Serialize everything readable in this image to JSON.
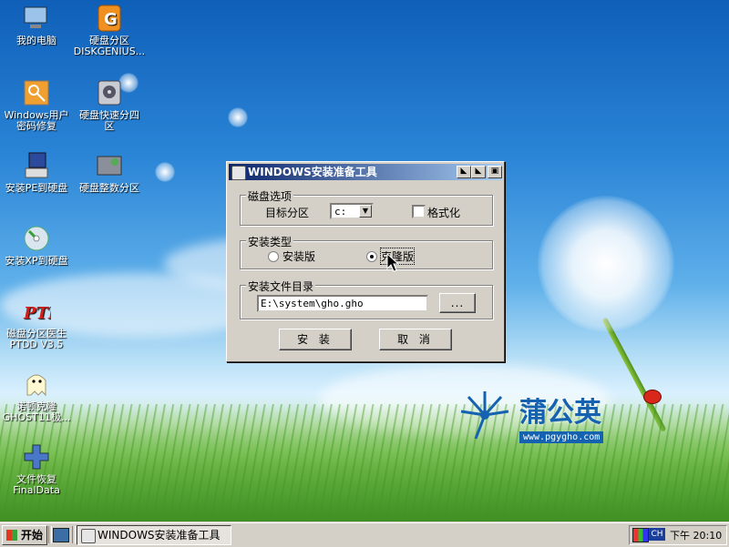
{
  "desktop": {
    "icons": [
      {
        "label": "我的电脑"
      },
      {
        "label": "硬盘分区\nDISKGENIUS..."
      },
      {
        "label": "Windows用户\n密码修复"
      },
      {
        "label": "硬盘快速分四\n区"
      },
      {
        "label": "安装PE到硬盘"
      },
      {
        "label": "硬盘整数分区"
      },
      {
        "label": "安装XP到硬盘"
      },
      {
        "label": "磁盘分区医生\nPTDD V3.5"
      },
      {
        "label": "诺顿克隆\nGHOST11极..."
      },
      {
        "label": "文件恢复\nFinalData"
      }
    ],
    "logo": {
      "text": "蒲公英",
      "url": "www.pgygho.com"
    }
  },
  "dialog": {
    "title": "WINDOWS安装准备工具",
    "disk_group": {
      "title": "磁盘选项",
      "target_label": "目标分区",
      "target_value": "c:",
      "format_label": "格式化",
      "format_checked": false
    },
    "install_type": {
      "title": "安装类型",
      "options": [
        "安装版",
        "克隆版"
      ],
      "selected": "克隆版"
    },
    "directory": {
      "title": "安装文件目录",
      "path": "E:\\system\\gho.gho",
      "browse_label": "..."
    },
    "buttons": {
      "install": "安 装",
      "cancel": "取 消"
    }
  },
  "taskbar": {
    "start_label": "开始",
    "task_item": "WINDOWS安装准备工具",
    "tray": {
      "ime": "CH",
      "time": "下午 20:10"
    }
  },
  "colors": {
    "title_start": "#0a246a",
    "title_end": "#a6caf0",
    "face": "#d4d0c8"
  }
}
